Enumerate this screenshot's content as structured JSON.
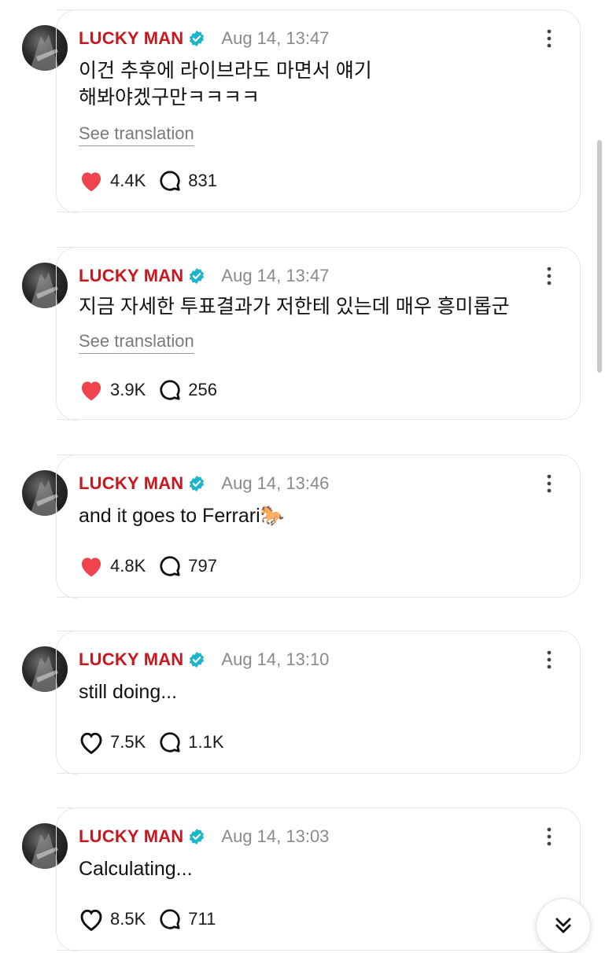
{
  "author": "LUCKY MAN",
  "see_translation": "See translation",
  "posts": [
    {
      "time": "Aug 14, 13:47",
      "text": "이건 추후에 라이브라도 마면서 얘기\n해봐야겠구만ㅋㅋㅋㅋ",
      "likes": "4.4K",
      "replies": "831",
      "liked": true
    },
    {
      "time": "Aug 14, 13:47",
      "text": "지금 자세한 투표결과가 저한테 있는데 매우 흥미롭군",
      "likes": "3.9K",
      "replies": "256",
      "liked": true
    },
    {
      "time": "Aug 14, 13:46",
      "text": "and it goes to Ferrari🐎",
      "likes": "4.8K",
      "replies": "797",
      "liked": true
    },
    {
      "time": "Aug 14, 13:10",
      "text": "still doing...",
      "likes": "7.5K",
      "replies": "1.1K",
      "liked": false
    },
    {
      "time": "Aug 14, 13:03",
      "text": "Calculating...",
      "likes": "8.5K",
      "replies": "711",
      "liked": false
    }
  ],
  "colors": {
    "author": "#c8171e",
    "like_active": "#f0434f",
    "badge": "#1bb6c9"
  },
  "icons": {
    "badge": "verified-badge-icon",
    "more": "more-vertical-icon",
    "like": "heart-icon",
    "reply": "reply-bubble-icon",
    "scroll_down": "double-chevron-down-icon"
  }
}
